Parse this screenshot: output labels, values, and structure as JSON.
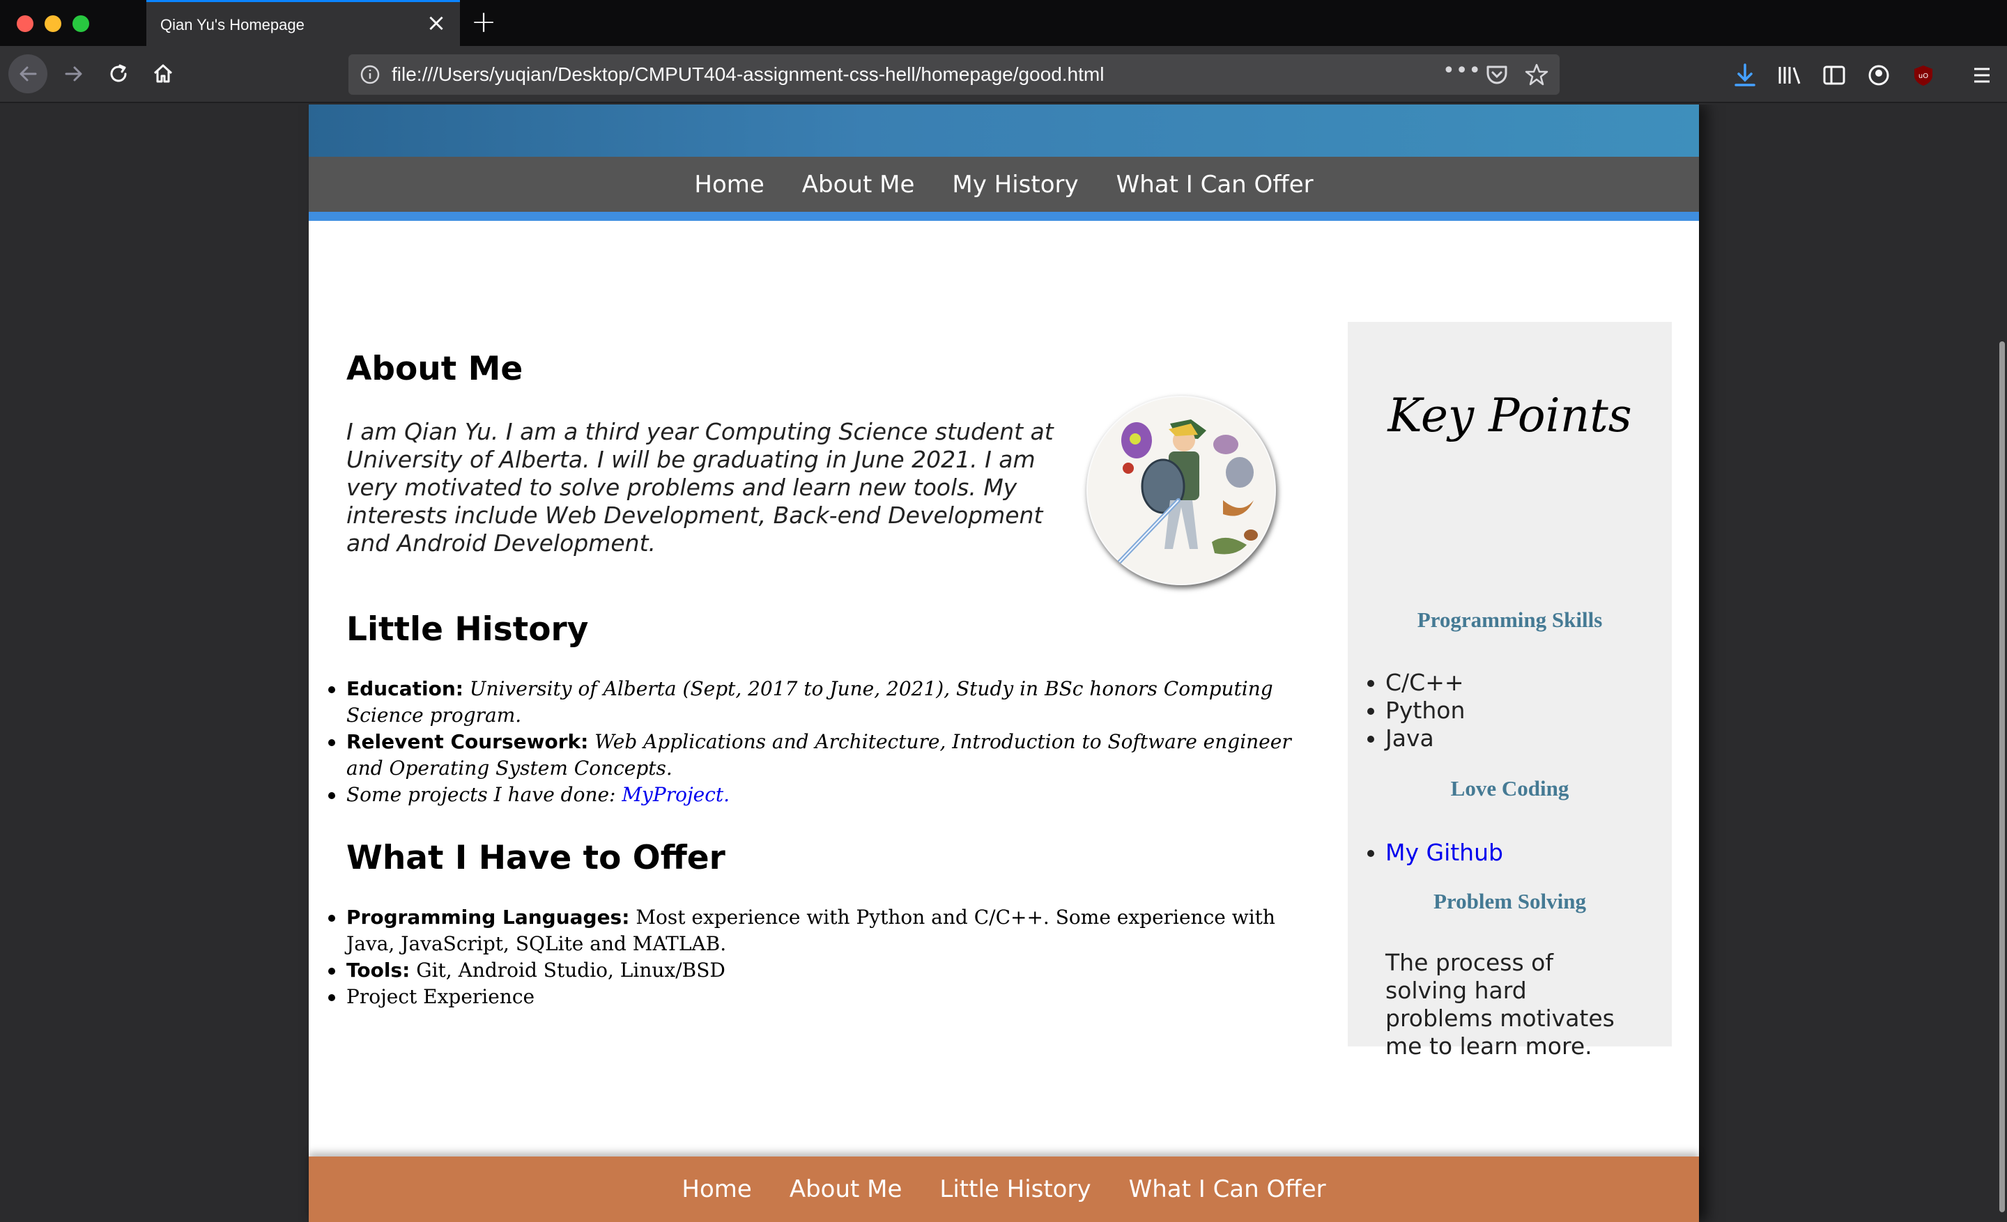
{
  "browser": {
    "tab_title": "Qian Yu's Homepage",
    "url": "file:///Users/yuqian/Desktop/CMPUT404-assignment-css-hell/homepage/good.html",
    "url_more": "•••"
  },
  "top_nav": [
    "Home",
    "About Me",
    "My History",
    "What I Can Offer"
  ],
  "about": {
    "heading": "About Me",
    "text": "I am Qian Yu. I am a third year Computing Science student at University of Alberta. I will be graduating in June 2021. I am very motivated to solve problems and learn new tools. My interests include Web Development, Back-end Development and Android Development."
  },
  "history": {
    "heading": "Little History",
    "items": [
      {
        "label": "Education:",
        "text": " University of Alberta (Sept, 2017 to June, 2021), Study in BSc honors Computing Science program."
      },
      {
        "label": "Relevent Coursework:",
        "text": " Web Applications and Architecture, Introduction to Software engineer and Operating System Concepts."
      }
    ],
    "projects_text": "Some projects I have done: ",
    "projects_link": "MyProject."
  },
  "offer": {
    "heading": "What I Have to Offer",
    "items": [
      {
        "label": "Programming Languages:",
        "text": " Most experience with Python and C/C++. Some experience with Java, JavaScript, SQLite and MATLAB."
      },
      {
        "label": "Tools:",
        "text": " Git, Android Studio, Linux/BSD"
      }
    ],
    "last_item": "Project Experience"
  },
  "sidebar": {
    "title": "Key Points",
    "skills_heading": "Programming Skills",
    "skills": [
      "C/C++",
      "Python",
      "Java"
    ],
    "coding_heading": "Love Coding",
    "github_link": "My Github",
    "problem_heading": "Problem Solving",
    "problem_text": "The process of solving hard problems motivates me to learn more."
  },
  "footer_nav": [
    "Home",
    "About Me",
    "Little History",
    "What I Can Offer"
  ]
}
